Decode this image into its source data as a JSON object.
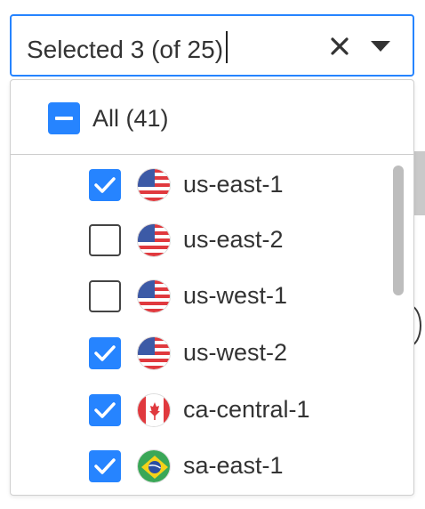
{
  "select": {
    "value": "Selected 3 (of 25)"
  },
  "menu": {
    "all_label": "All (41)",
    "options": [
      {
        "label": "us-east-1",
        "checked": true,
        "flag": "us-flag-icon"
      },
      {
        "label": "us-east-2",
        "checked": false,
        "flag": "us-flag-icon"
      },
      {
        "label": "us-west-1",
        "checked": false,
        "flag": "us-flag-icon"
      },
      {
        "label": "us-west-2",
        "checked": true,
        "flag": "us-flag-icon"
      },
      {
        "label": "ca-central-1",
        "checked": true,
        "flag": "canada-flag-icon"
      },
      {
        "label": "sa-east-1",
        "checked": true,
        "flag": "brazil-flag-icon"
      }
    ]
  },
  "icons": {
    "clear": "close-icon",
    "dropdown": "caret-down-icon",
    "all_checkbox": "indeterminate-checkbox-icon"
  },
  "colors": {
    "accent": "#2684ff",
    "text": "#333333",
    "menu_border": "#cfcfcf",
    "scrollbar_thumb": "#bdbdbd"
  },
  "scroll": {
    "thumb_fraction": 0.4,
    "position_fraction": 0.0
  }
}
